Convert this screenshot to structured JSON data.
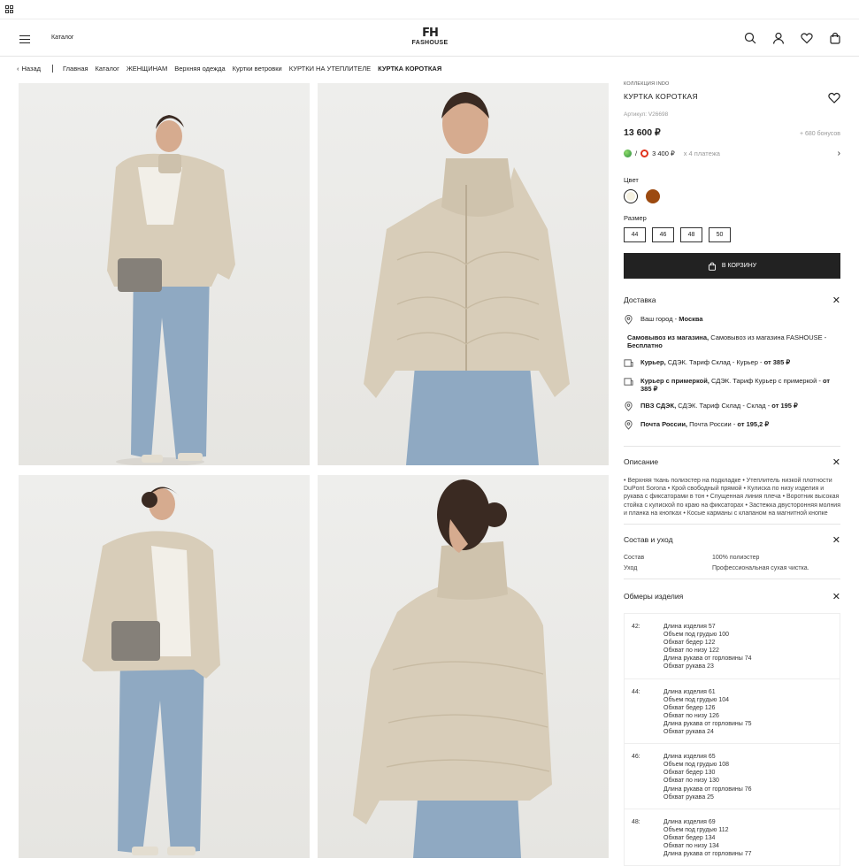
{
  "header": {
    "catalog": "Каталог",
    "logo_mark": "FH",
    "logo_name": "FASHOUSE"
  },
  "breadcrumbs": {
    "back": "Назад",
    "items": [
      "Главная",
      "Каталог",
      "ЖЕНЩИНАМ",
      "Верхняя одежда",
      "Куртки ветровки",
      "КУРТКИ НА УТЕПЛИТЕЛЕ",
      "КУРТКА КОРОТКАЯ"
    ]
  },
  "product": {
    "collection": "КОЛЛЕКЦИЯ INDO",
    "name": "КУРТКА КОРОТКАЯ",
    "article": "Артикул: V26698",
    "price": "13 600 ₽",
    "bonus": "+ 680 бонусов",
    "split_price": "3 400 ₽",
    "split_times": "x 4 платежа",
    "color_label": "Цвет",
    "colors": [
      "#f5f1e0",
      "#9c4a10"
    ],
    "size_label": "Размер",
    "sizes": [
      "44",
      "46",
      "48",
      "50"
    ],
    "cart": "В КОРЗИНУ"
  },
  "delivery": {
    "title": "Доставка",
    "city_label": "Ваш город -",
    "city": "Москва",
    "pickup_b": "Самовывоз из магазина,",
    "pickup_r": "Самовывоз из магазина FASHOUSE -",
    "pickup_free": "Бесплатно",
    "courier_b": "Курьер,",
    "courier_r": "СДЭК. Тариф Склад - Курьер -",
    "courier_p": "от 385 ₽",
    "fitting_b": "Курьер с примеркой,",
    "fitting_r": "СДЭК. Тариф Курьер с примеркой -",
    "fitting_p": "от 385 ₽",
    "pvz_b": "ПВЗ СДЭК,",
    "pvz_r": "СДЭК. Тариф Склад - Склад -",
    "pvz_p": "от 195 ₽",
    "post_b": "Почта России,",
    "post_r": "Почта России -",
    "post_p": "от 195,2 ₽"
  },
  "description": {
    "title": "Описание",
    "text": "• Верхняя ткань полиэстер на подкладке • Утеплитель низкой плотности DuPont Sorona • Крой свободный прямой • Кулиска по низу изделия и рукава с фиксаторами в тон • Спущенная линия плеча • Воротник высокая стойка с кулиской по краю на фиксаторах • Застежка двусторонняя молния и планка на кнопках • Косые карманы с клапаном на магнитной кнопке"
  },
  "care": {
    "title": "Состав и уход",
    "rows": [
      {
        "k": "Состав",
        "v": "100% полиэстер"
      },
      {
        "k": "Уход",
        "v": "Профессиональная сухая чистка."
      }
    ]
  },
  "measurements": {
    "title": "Обмеры изделия",
    "rows": [
      {
        "size": "42:",
        "lines": [
          "Длина изделия 57",
          "Объем под грудью 100",
          "Обхват бедер 122",
          "Обхват  по низу 122",
          "Длина рукава от горловины 74",
          "Обхват рукава 23"
        ]
      },
      {
        "size": "44:",
        "lines": [
          "Длина изделия 61",
          "Объем под грудью 104",
          "Обхват бедер 126",
          "Обхват  по низу 126",
          "Длина рукава от горловины 75",
          "Обхват рукава 24"
        ]
      },
      {
        "size": "46:",
        "lines": [
          "Длина изделия 65",
          "Объем под грудью 108",
          "Обхват бедер 130",
          "Обхват  по низу 130",
          "Длина рукава от горловины 76",
          "Обхват рукава 25"
        ]
      },
      {
        "size": "48:",
        "lines": [
          "Длина изделия 69",
          "Объем под грудью 112",
          "Обхват бедер 134",
          "Обхват  по низу 134",
          "Длина рукава от горловины 77"
        ]
      }
    ]
  },
  "icons": {
    "menu": "menu-icon",
    "search": "search-icon",
    "account": "user-icon",
    "favorites": "heart-icon",
    "cart": "bag-icon"
  }
}
